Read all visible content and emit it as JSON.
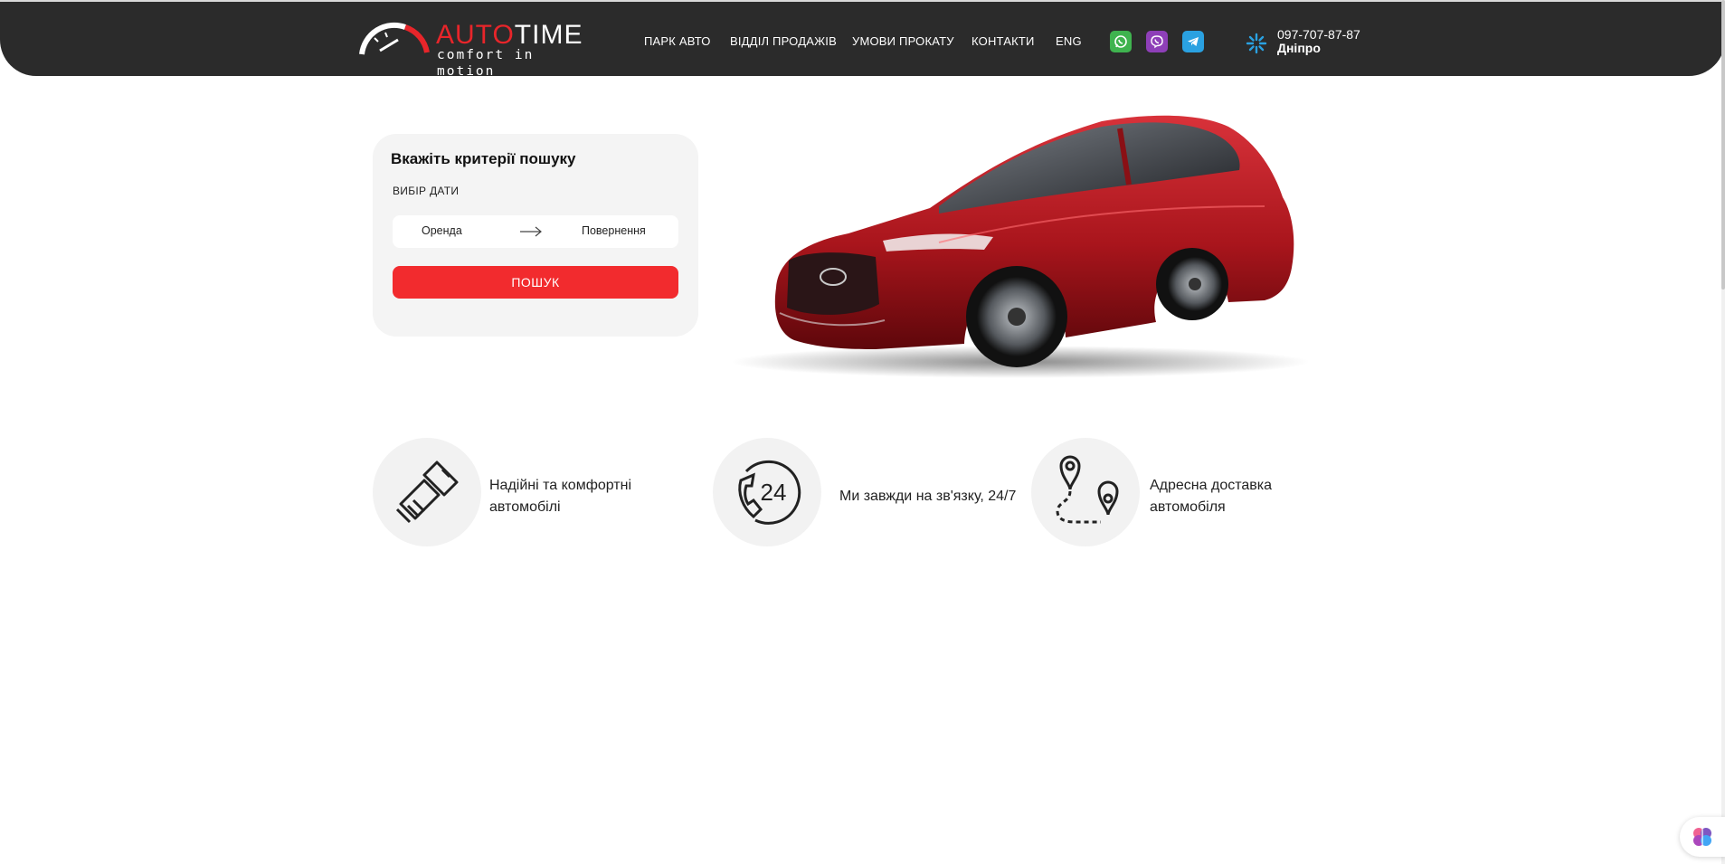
{
  "brand": {
    "name_red": "AUTO",
    "name_white": "TIME",
    "tagline": "comfort in motion"
  },
  "nav": {
    "items": [
      {
        "label": "ПАРК АВТО"
      },
      {
        "label": "ВІДДІЛ ПРОДАЖІВ"
      },
      {
        "label": "УМОВИ ПРОКАТУ"
      },
      {
        "label": "КОНТАКТИ"
      },
      {
        "label": "ENG"
      }
    ]
  },
  "social": {
    "whatsapp": "whatsapp-icon",
    "viber": "viber-icon",
    "telegram": "telegram-icon"
  },
  "contact": {
    "phone": "097-707-87-87",
    "city": "Дніпро"
  },
  "search": {
    "title": "Вкажіть критерії пошуку",
    "dates_label": "ВИБІР ДАТИ",
    "from_label": "Оренда",
    "to_label": "Повернення",
    "button_label": "ПОШУК"
  },
  "features": [
    {
      "icon": "seatbelt-icon",
      "line1": "Надійні та комфортні",
      "line2": "автомобілі"
    },
    {
      "icon": "phone-24-icon",
      "line1": "Ми завжди на зв'язку, 24/7",
      "line2": ""
    },
    {
      "icon": "route-pin-icon",
      "line1": "Адресна доставка",
      "line2": "автомобіля"
    }
  ],
  "colors": {
    "header_bg": "#2b2b2b",
    "accent_red": "#f22b2e",
    "card_bg": "#f4f4f4"
  }
}
